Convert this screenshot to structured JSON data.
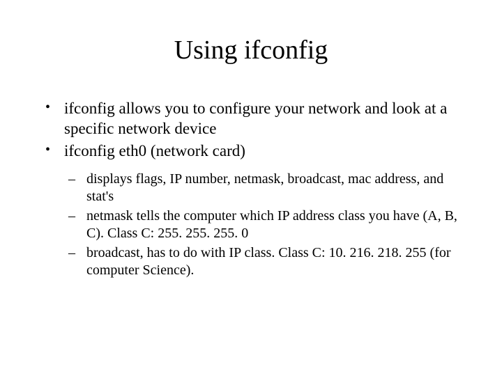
{
  "title": "Using ifconfig",
  "bullets": [
    "ifconfig allows you to configure your network and look at a specific network device",
    "ifconfig eth0 (network card)"
  ],
  "subbullets": [
    "displays flags, IP number, netmask, broadcast, mac address, and stat's",
    "netmask tells the computer which IP address class you have (A, B, C).  Class C: 255. 255. 255. 0",
    "broadcast, has to do with IP class. Class C: 10. 216. 218. 255 (for computer Science)."
  ]
}
